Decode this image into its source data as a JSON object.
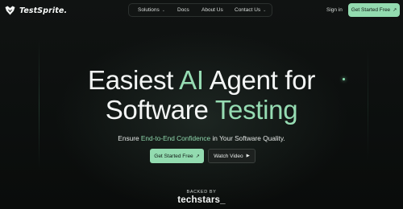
{
  "brand": {
    "name": "TestSprite.",
    "logo_icon": "sprite-logo-icon"
  },
  "nav": {
    "items": [
      {
        "label": "Solutions",
        "has_dropdown": true
      },
      {
        "label": "Docs"
      },
      {
        "label": "About Us"
      },
      {
        "label": "Contact Us",
        "has_dropdown": true
      }
    ]
  },
  "header": {
    "sign_in": "Sign in",
    "cta": "Get Started Free",
    "cta_icon": "arrow-up-right-icon"
  },
  "hero": {
    "line1_pre": "Easiest ",
    "line1_accent": "AI",
    "line1_post": " Agent for",
    "line2_pre": "Software ",
    "line2_accent": "Testing",
    "subtitle_pre": "Ensure ",
    "subtitle_accent": "End-to-End Confidence",
    "subtitle_post": " in Your Software Quality.",
    "primary_cta": "Get Started Free",
    "secondary_cta": "Watch Video"
  },
  "backers": {
    "label": "BACKED BY",
    "name": "techstars_"
  },
  "colors": {
    "accent": "#96dcb3",
    "background": "#0b0d0c",
    "button": "#93dbb0"
  }
}
